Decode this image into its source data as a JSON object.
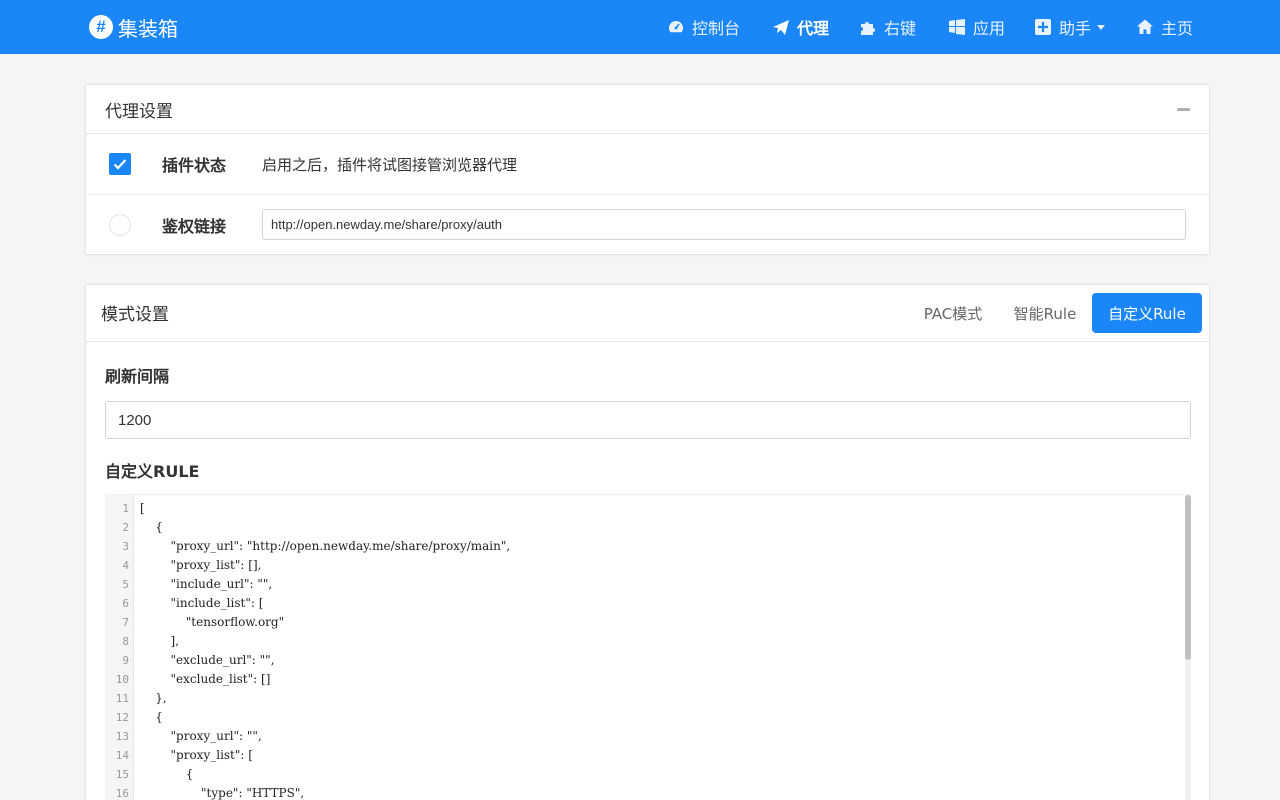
{
  "brand": {
    "logo": "#",
    "name": "集装箱"
  },
  "nav": [
    {
      "label": "控制台",
      "icon": "tachometer-icon"
    },
    {
      "label": "代理",
      "icon": "paper-plane-icon",
      "active": true
    },
    {
      "label": "右键",
      "icon": "puzzle-icon"
    },
    {
      "label": "应用",
      "icon": "windows-icon"
    },
    {
      "label": "助手",
      "icon": "plus-square-icon",
      "dropdown": true
    },
    {
      "label": "主页",
      "icon": "home-icon"
    }
  ],
  "proxy_settings": {
    "title": "代理设置",
    "plugin_status": {
      "label": "插件状态",
      "description": "启用之后，插件将试图接管浏览器代理",
      "checked": true
    },
    "auth_link": {
      "label": "鉴权链接",
      "value": "http://open.newday.me/share/proxy/auth"
    }
  },
  "mode_settings": {
    "title": "模式设置",
    "tabs": [
      {
        "label": "PAC模式"
      },
      {
        "label": "智能Rule"
      },
      {
        "label": "自定义Rule",
        "active": true
      }
    ],
    "refresh_interval": {
      "label": "刷新间隔",
      "value": "1200"
    },
    "custom_rule": {
      "label": "自定义RULE",
      "lines": [
        "[",
        "    {",
        "        \"proxy_url\": \"http://open.newday.me/share/proxy/main\",",
        "        \"proxy_list\": [],",
        "        \"include_url\": \"\",",
        "        \"include_list\": [",
        "            \"tensorflow.org\"",
        "        ],",
        "        \"exclude_url\": \"\",",
        "        \"exclude_list\": []",
        "    },",
        "    {",
        "        \"proxy_url\": \"\",",
        "        \"proxy_list\": [",
        "            {",
        "                \"type\": \"HTTPS\","
      ],
      "line_numbers": [
        "1",
        "2",
        "3",
        "4",
        "5",
        "6",
        "7",
        "8",
        "9",
        "10",
        "11",
        "12",
        "13",
        "14",
        "15",
        "16"
      ]
    }
  },
  "colors": {
    "primary": "#1a86f8",
    "background": "#f4f5f7"
  }
}
